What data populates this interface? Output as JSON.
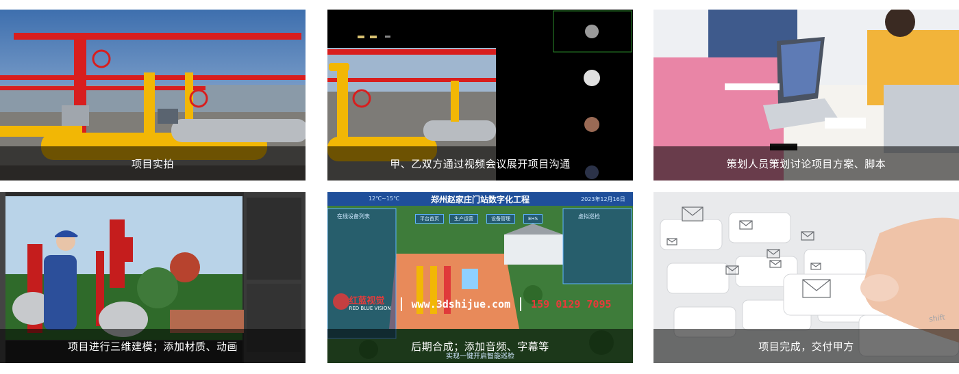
{
  "cards": [
    {
      "caption": "项目实拍",
      "scene_icon": "pipeline-photo"
    },
    {
      "caption": "甲、乙双方通过视频会议展开项目沟通",
      "scene_icon": "video-conference"
    },
    {
      "caption": "策划人员策划讨论项目方案、脚本",
      "scene_icon": "team-meeting-photo"
    },
    {
      "caption": "项目进行三维建模；添加材质、动画",
      "scene_icon": "3d-modeling-software"
    },
    {
      "caption": "后期合成；添加音频、字幕等",
      "scene_icon": "digital-station-render",
      "subcaption": "实现一键开启智能巡检",
      "hud_title": "郑州赵家庄门站数字化工程",
      "hud_left_panel": "在线设备列表",
      "hud_right_panel": "虚拟巡检",
      "hud_temp": "12℃~15℃",
      "hud_date": "2023年12月16日",
      "hud_tabs": [
        "平台首页",
        "生产运营",
        "设备管理",
        "EHS"
      ],
      "brand_logo": "红蓝视觉",
      "brand_logo_en": "RED BLUE VISION",
      "brand_site": "www.3dshijue.com",
      "brand_phone": "159 0129 7095"
    },
    {
      "caption": "项目完成，交付甲方",
      "scene_icon": "keyboard-email-photo",
      "key_label": "shift"
    }
  ],
  "colors": {
    "caption_bg": "rgba(0,0,0,0.55)",
    "pipe_yellow": "#f2b705",
    "pipe_red": "#d81e1e",
    "brand_red": "#e83a3a"
  }
}
